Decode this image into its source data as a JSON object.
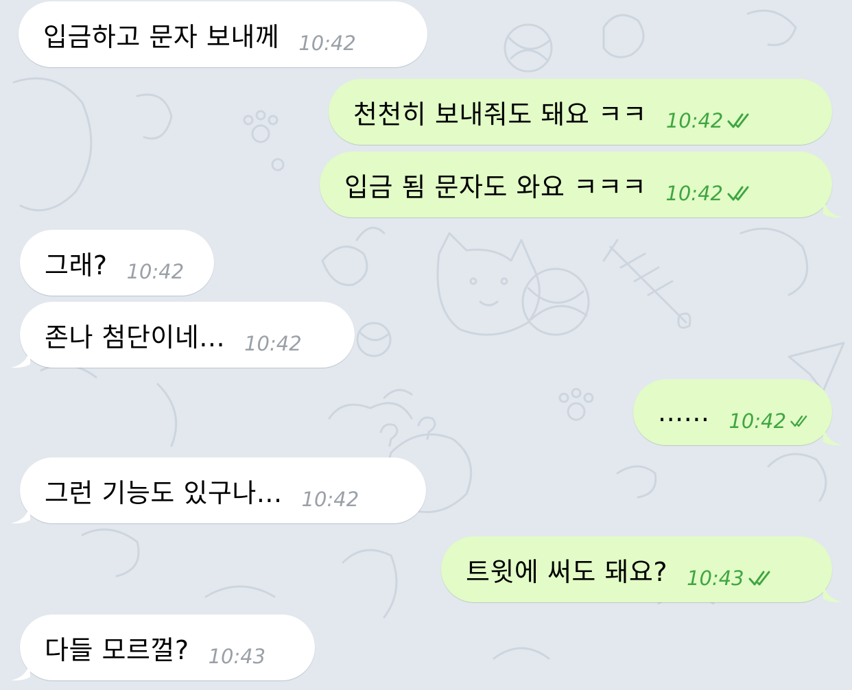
{
  "theme": {
    "background": "#e3e8ee",
    "incoming_bubble": "#ffffff",
    "outgoing_bubble": "#e2fbc7",
    "incoming_time_color": "#9aa0a7",
    "outgoing_time_color": "#3fa641",
    "read_check_icon": "double-check-icon"
  },
  "messages": [
    {
      "side": "in",
      "text": "입금하고 문자 보내께",
      "time": "10:42"
    },
    {
      "side": "out",
      "text": "천천히 보내줘도 돼요 ㅋㅋ",
      "time": "10:42",
      "read": true
    },
    {
      "side": "out",
      "text": "입금 됨 문자도 와요 ㅋㅋㅋ",
      "time": "10:42",
      "read": true
    },
    {
      "side": "in",
      "text": "그래?",
      "time": "10:42"
    },
    {
      "side": "in",
      "text": "존나 첨단이네...",
      "time": "10:42"
    },
    {
      "side": "out",
      "text": "......",
      "time": "10:42",
      "read": true
    },
    {
      "side": "in",
      "text": "그런 기능도 있구나...",
      "time": "10:42"
    },
    {
      "side": "out",
      "text": "트윗에 써도 돼요?",
      "time": "10:43",
      "read": true
    },
    {
      "side": "in",
      "text": "다들 모르껄?",
      "time": "10:43"
    }
  ]
}
